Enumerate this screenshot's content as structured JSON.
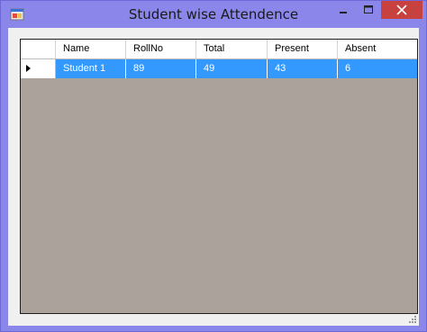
{
  "window": {
    "title": "Student wise Attendence",
    "controls": {
      "minimize_icon": "minimize-icon",
      "maximize_icon": "maximize-icon",
      "close_icon": "close-icon"
    },
    "colors": {
      "frame": "#8a86ea",
      "close": "#c7413f",
      "selection": "#3399ff",
      "grid_bg": "#aaa29b"
    }
  },
  "grid": {
    "columns": [
      "Name",
      "RollNo",
      "Total",
      "Present",
      "Absent"
    ],
    "rows": [
      {
        "cells": [
          "Student 1",
          "89",
          "49",
          "43",
          "6"
        ],
        "selected": true
      }
    ]
  }
}
